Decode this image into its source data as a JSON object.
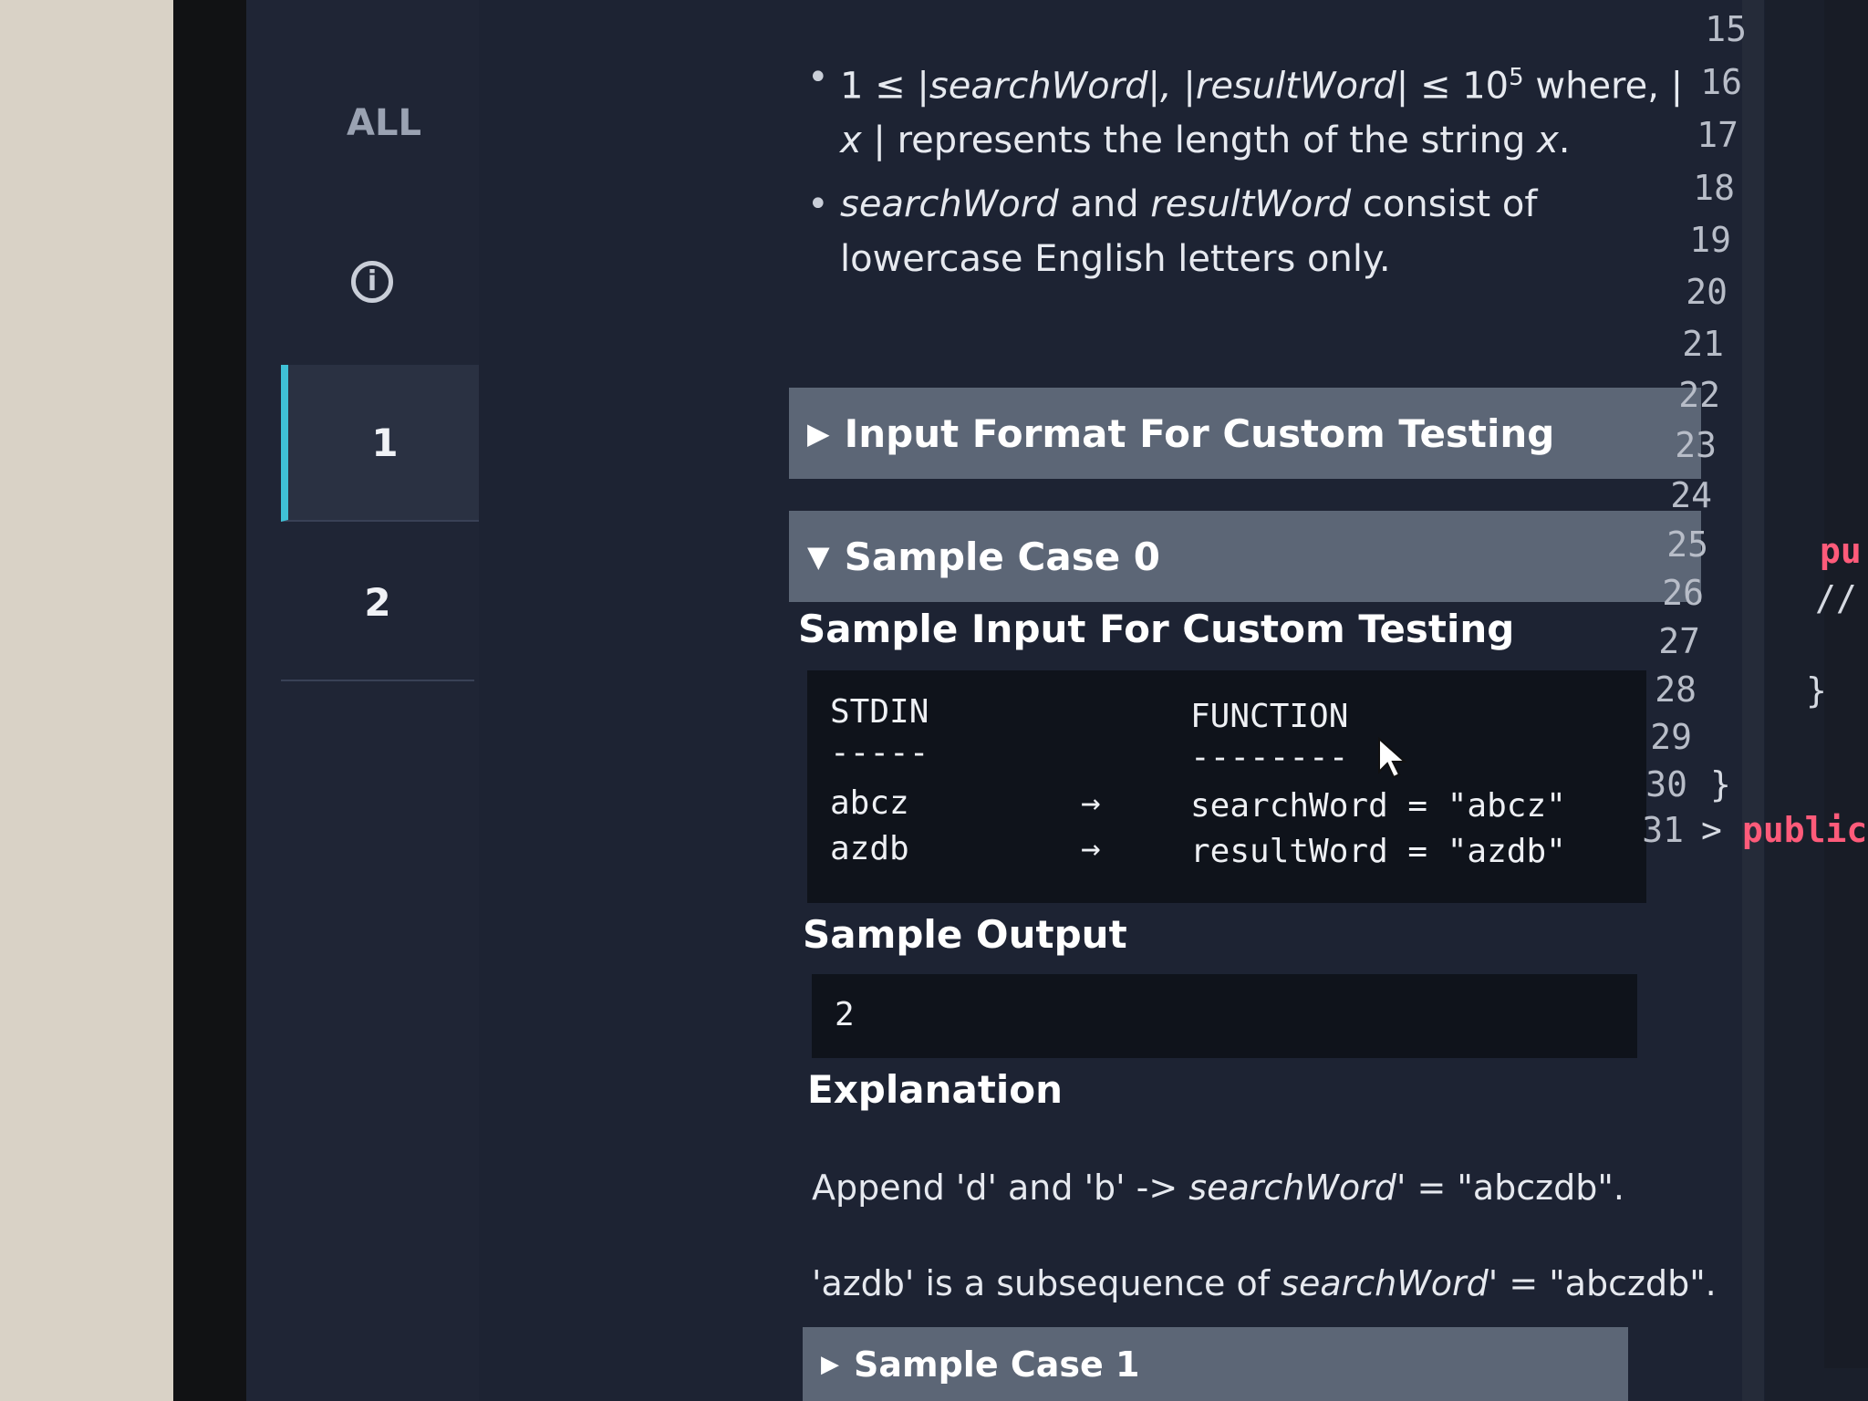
{
  "nav": {
    "all_label": "ALL",
    "info_glyph": "i",
    "items": [
      {
        "label": "1",
        "active": true
      },
      {
        "label": "2",
        "active": false
      }
    ]
  },
  "constraints": [
    {
      "parts": [
        "1 ≤ ",
        "|searchWord|, |resultWord|",
        " ≤ 10",
        "5",
        " where, ",
        "| x |",
        " represents the length of the string ",
        "x",
        "."
      ]
    },
    {
      "parts": [
        "searchWord",
        " and ",
        "resultWord",
        " consist of lowercase English letters only."
      ]
    }
  ],
  "sections": {
    "input_format_label": "Input Format For Custom Testing",
    "sample0_label": "Sample Case 0",
    "sample_input_heading": "Sample Input For Custom Testing",
    "sample_output_heading": "Sample Output",
    "explanation_heading": "Explanation",
    "sample1_label": "Sample Case 1"
  },
  "sample_input": {
    "col1_header": "STDIN",
    "col2_header": "FUNCTION",
    "col1_rule": "-----",
    "col2_rule": "--------",
    "arrow": "→",
    "rows": [
      {
        "stdin": "abcz",
        "function": "searchWord = \"abcz\""
      },
      {
        "stdin": "azdb",
        "function": "resultWord = \"azdb\""
      }
    ]
  },
  "sample_output": {
    "value": "2"
  },
  "explanation": {
    "line1": {
      "a": "Append 'd' and 'b' -> ",
      "b": "searchWord",
      "c": "' = \"abczdb\"."
    },
    "line2": {
      "a": "'azdb' is a subsequence of ",
      "b": "searchWord",
      "c": "' = \"abczdb\"."
    }
  },
  "editor": {
    "line_numbers": [
      "15",
      "16",
      "17",
      "18",
      "19",
      "20",
      "21",
      "22",
      "23",
      "24",
      "25",
      "26",
      "27",
      "28",
      "29",
      "30",
      "31"
    ],
    "fragments": {
      "line25": "pu",
      "line26": "//",
      "line28": "}",
      "line30": "}",
      "line31_chevron": ">",
      "line31": "public c"
    },
    "keyword_color": "#ff5b7a"
  },
  "colors": {
    "accent": "#3fc1d6",
    "panel_bg": "#1d2333",
    "bar_bg": "#5c6676",
    "code_bg": "#0f131b"
  }
}
